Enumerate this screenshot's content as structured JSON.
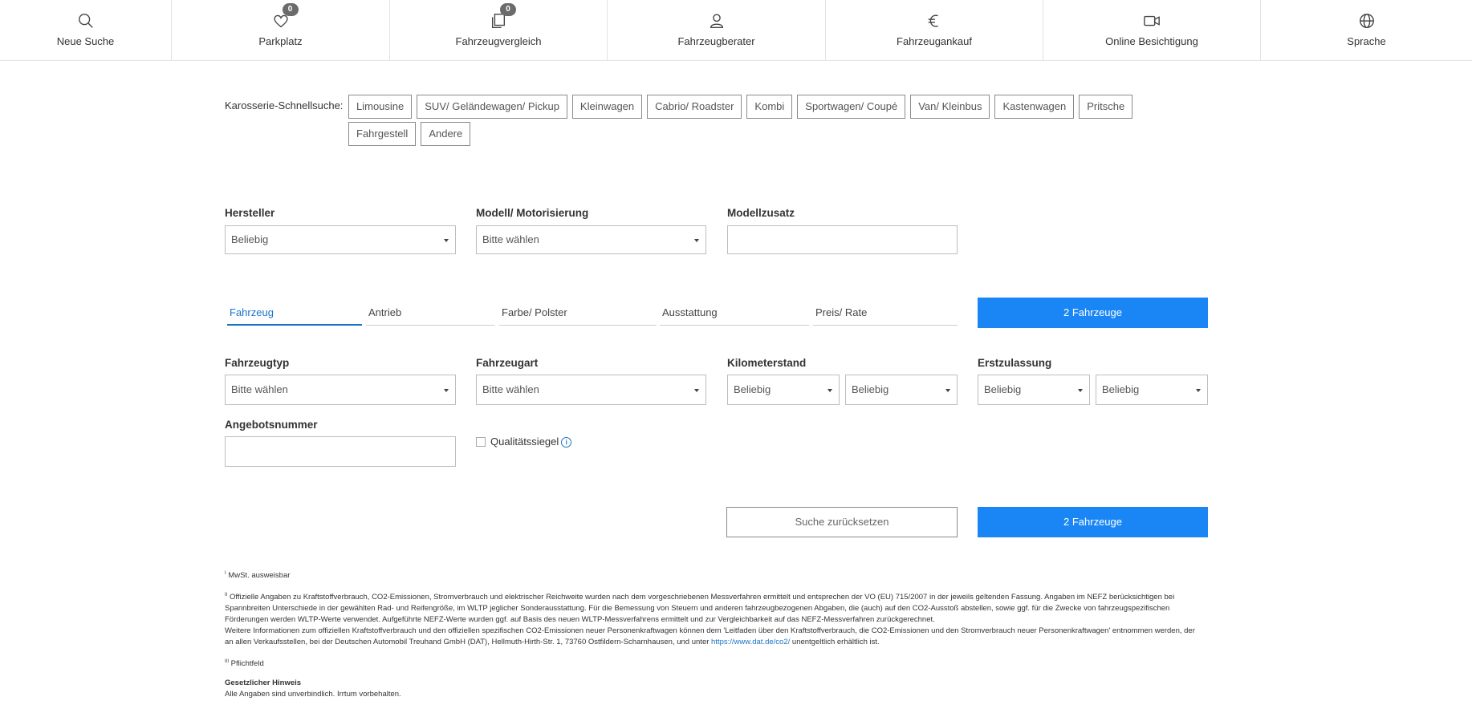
{
  "nav": [
    {
      "label": "Neue Suche",
      "icon": "search-icon"
    },
    {
      "label": "Parkplatz",
      "icon": "heart-icon",
      "badge": "0"
    },
    {
      "label": "Fahrzeugvergleich",
      "icon": "compare-icon",
      "badge": "0"
    },
    {
      "label": "Fahrzeugberater",
      "icon": "person-icon"
    },
    {
      "label": "Fahrzeugankauf",
      "icon": "euro-icon"
    },
    {
      "label": "Online Besichtigung",
      "icon": "video-camera-icon"
    },
    {
      "label": "Sprache",
      "icon": "globe-icon"
    }
  ],
  "body_search": {
    "label": "Karosserie-Schnellsuche:",
    "chips": [
      "Limousine",
      "SUV/ Geländewagen/ Pickup",
      "Kleinwagen",
      "Cabrio/ Roadster",
      "Kombi",
      "Sportwagen/ Coupé",
      "Van/ Kleinbus",
      "Kastenwagen",
      "Pritsche",
      "Fahrgestell",
      "Andere"
    ]
  },
  "filters": {
    "hersteller": {
      "label": "Hersteller",
      "value": "Beliebig"
    },
    "modell": {
      "label": "Modell/ Motorisierung",
      "value": "Bitte wählen"
    },
    "modellzusatz": {
      "label": "Modellzusatz",
      "value": ""
    }
  },
  "tabs": [
    "Fahrzeug",
    "Antrieb",
    "Farbe/ Polster",
    "Ausstattung",
    "Preis/ Rate"
  ],
  "result_button": "2 Fahrzeuge",
  "vehicle": {
    "fahrzeugtyp": {
      "label": "Fahrzeugtyp",
      "value": "Bitte wählen"
    },
    "fahrzeugart": {
      "label": "Fahrzeugart",
      "value": "Bitte wählen"
    },
    "kilometerstand": {
      "label": "Kilometerstand",
      "from": "Beliebig",
      "to": "Beliebig"
    },
    "erstzulassung": {
      "label": "Erstzulassung",
      "from": "Beliebig",
      "to": "Beliebig"
    },
    "angebotsnummer": {
      "label": "Angebotsnummer",
      "value": ""
    },
    "qualitaetssiegel": {
      "label": "Qualitätssiegel",
      "checked": false,
      "info_icon": "i"
    }
  },
  "actions": {
    "reset": "Suche zurücksetzen",
    "submit": "2 Fahrzeuge"
  },
  "footnotes": {
    "fn1_mark": "I",
    "fn1": "MwSt. ausweisbar",
    "fn2_mark": "II",
    "fn2_p1": "Offizielle Angaben zu Kraftstoffverbrauch, CO2-Emissionen, Stromverbrauch und elektrischer Reichweite wurden nach dem vorgeschriebenen Messverfahren ermittelt und entsprechen der VO (EU) 715/2007 in der jeweils geltenden Fassung. Angaben im NEFZ berücksichtigen bei Spannbreiten Unterschiede in der gewählten Rad- und Reifengröße, im WLTP jeglicher Sonderausstattung. Für die Bemessung von Steuern und anderen fahrzeugbezogenen Abgaben, die (auch) auf den CO2-Ausstoß abstellen, sowie ggf. für die Zwecke von fahrzeugspezifischen Förderungen werden WLTP-Werte verwendet. Aufgeführte NEFZ-Werte wurden ggf. auf Basis des neuen WLTP-Messverfahrens ermittelt und zur Vergleichbarkeit auf das NEFZ-Messverfahren zurückgerechnet.",
    "fn2_p2": "Weitere Informationen zum offiziellen Kraftstoffverbrauch und den offiziellen spezifischen CO2-Emissionen neuer Personenkraftwagen können dem 'Leitfaden über den Kraftstoffverbrauch, die CO2-Emissionen und den Stromverbrauch neuer Personenkraftwagen' entnommen werden, der an allen Verkaufsstellen, bei der Deutschen Automobil Treuhand GmbH (DAT), Hellmuth-Hirth-Str. 1, 73760 Ostfildern-Scharnhausen, und unter",
    "fn2_link": "https://www.dat.de/co2/",
    "fn2_p3": "unentgeltlich erhältlich ist.",
    "fn3_mark": "III",
    "fn3": "Pflichtfeld",
    "legal_title": "Gesetzlicher Hinweis",
    "legal_text": "Alle Angaben sind unverbindlich. Irrtum vorbehalten."
  }
}
